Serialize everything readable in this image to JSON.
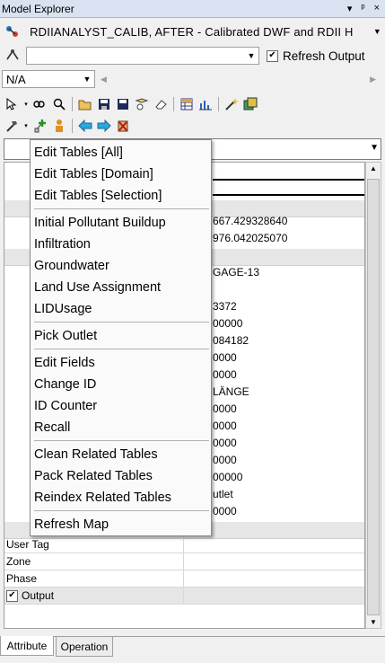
{
  "window": {
    "title": "Model Explorer",
    "pin_icon": "pin-icon",
    "close_glyph": "×",
    "dropdown_glyph": "▾",
    "pin_glyph": "ᵖ"
  },
  "model_row": {
    "model_value": "RDIIANALYST_CALIB, AFTER - Calibrated DWF and RDII H"
  },
  "scenario_row": {
    "value": "",
    "refresh_label": "Refresh Output",
    "refresh_checked": true
  },
  "na_row": {
    "value": "N/A"
  },
  "grid": {
    "values": [
      "667.429328640",
      "976.042025070",
      "GAGE-13",
      "3372",
      "00000",
      "084182",
      "0000",
      "0000",
      "LÄNGE",
      "0000",
      "0000",
      "0000",
      "0000",
      "00000",
      "utlet",
      "0000"
    ],
    "rows": [
      {
        "label": "User Tag",
        "value": ""
      },
      {
        "label": "Zone",
        "value": ""
      },
      {
        "label": "Phase",
        "value": ""
      }
    ],
    "output_label": "Output",
    "output_checked": true
  },
  "context_menu": {
    "items": [
      "Edit Tables [All]",
      "Edit Tables [Domain]",
      "Edit Tables [Selection]",
      "Initial Pollutant Buildup",
      "Infiltration",
      "Groundwater",
      "Land Use Assignment",
      "LIDUsage",
      "Pick Outlet",
      "Edit Fields",
      "Change ID",
      "ID Counter",
      "Recall",
      "Clean Related Tables",
      "Pack Related Tables",
      "Reindex Related Tables",
      "Refresh Map"
    ]
  },
  "tabs": [
    "Attribute",
    "Operation"
  ]
}
